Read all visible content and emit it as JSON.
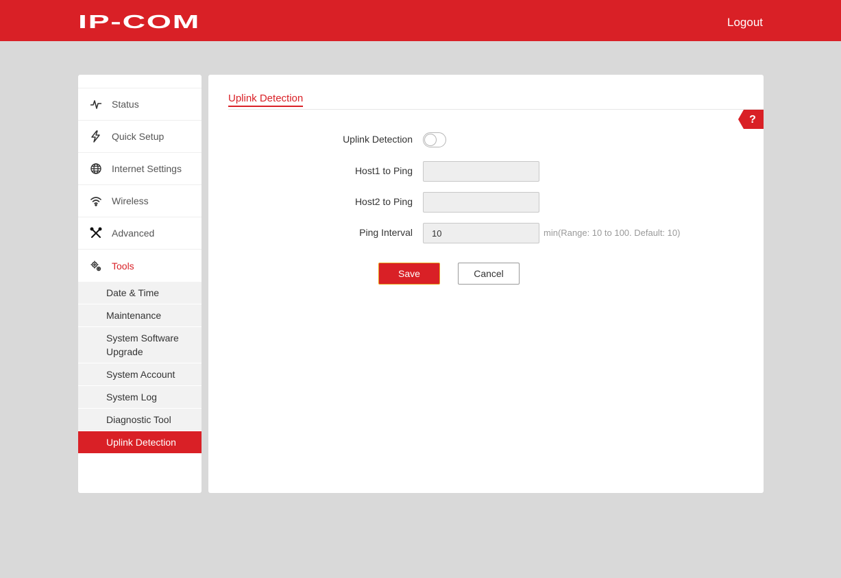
{
  "header": {
    "logo_text": "IP-COM",
    "logout_label": "Logout"
  },
  "sidebar": {
    "items": [
      {
        "label": "Status",
        "icon": "pulse-icon"
      },
      {
        "label": "Quick Setup",
        "icon": "lightning-icon"
      },
      {
        "label": "Internet Settings",
        "icon": "globe-icon"
      },
      {
        "label": "Wireless",
        "icon": "wifi-icon"
      },
      {
        "label": "Advanced",
        "icon": "tools-icon"
      },
      {
        "label": "Tools",
        "icon": "gears-icon"
      }
    ],
    "sub_items": [
      {
        "label": "Date & Time"
      },
      {
        "label": "Maintenance"
      },
      {
        "label": "System Software Upgrade"
      },
      {
        "label": "System Account"
      },
      {
        "label": "System Log"
      },
      {
        "label": "Diagnostic Tool"
      },
      {
        "label": "Uplink Detection"
      }
    ],
    "active_sub": "Uplink Detection"
  },
  "main": {
    "tab_label": "Uplink Detection",
    "help_label": "?",
    "form": {
      "uplink_label": "Uplink Detection",
      "uplink_enabled": false,
      "host1_label": "Host1 to Ping",
      "host1_value": "",
      "host2_label": "Host2 to Ping",
      "host2_value": "",
      "interval_label": "Ping Interval",
      "interval_value": "10",
      "interval_hint": "min(Range: 10 to 100. Default: 10)"
    },
    "save_label": "Save",
    "cancel_label": "Cancel"
  },
  "colors": {
    "brand": "#d92026",
    "background": "#d9d9d9",
    "save_border": "#e8a21c"
  }
}
